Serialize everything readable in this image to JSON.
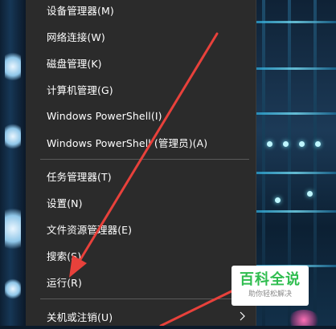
{
  "menu": {
    "items": [
      {
        "label": "设备管理器(M)"
      },
      {
        "label": "网络连接(W)"
      },
      {
        "label": "磁盘管理(K)"
      },
      {
        "label": "计算机管理(G)"
      },
      {
        "label": "Windows PowerShell(I)"
      },
      {
        "label": "Windows PowerShell (管理员)(A)"
      },
      {
        "label": "任务管理器(T)"
      },
      {
        "label": "设置(N)"
      },
      {
        "label": "文件资源管理器(E)"
      },
      {
        "label": "搜索(S)"
      },
      {
        "label": "运行(R)"
      },
      {
        "label": "关机或注销(U)"
      }
    ],
    "submenu_icon": "chevron-right-icon"
  },
  "annotation": {
    "arrow_color": "#e8413b"
  },
  "watermark": {
    "title": "百科全说",
    "subtitle": "助你轻松解决"
  },
  "colors": {
    "menu_bg": "#2b2b2b",
    "menu_text": "#ffffff",
    "separator": "#5a5a5a",
    "watermark_green": "#2fbd4f"
  }
}
